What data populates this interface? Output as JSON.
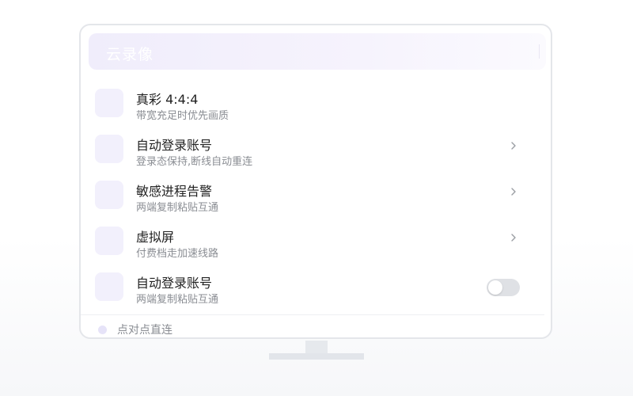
{
  "header": {
    "title": "云录像"
  },
  "items": [
    {
      "title": "真彩 4:4:4",
      "subtitle": "带宽充足时优先画质",
      "control": "none"
    },
    {
      "title": "自动登录账号",
      "subtitle": "登录态保持,断线自动重连",
      "control": "chevron"
    },
    {
      "title": "敏感进程告警",
      "subtitle": "两端复制粘贴互通",
      "control": "chevron"
    },
    {
      "title": "虚拟屏",
      "subtitle": "付费档走加速线路",
      "control": "chevron"
    },
    {
      "title": "自动登录账号",
      "subtitle": "两端复制粘贴互通",
      "control": "toggle",
      "toggle_on": false
    }
  ],
  "footer": {
    "label": "点对点直连"
  },
  "icons": {
    "chevron": "chevron-right-icon",
    "item_placeholder": "settings-item-icon",
    "status": "status-dot-icon"
  },
  "colors": {
    "header_gradient_start": "#f0edfb",
    "icon_bg": "#f2f0fc",
    "toggle_off": "#dfe1e5",
    "subtitle_text": "#8a8d93"
  }
}
